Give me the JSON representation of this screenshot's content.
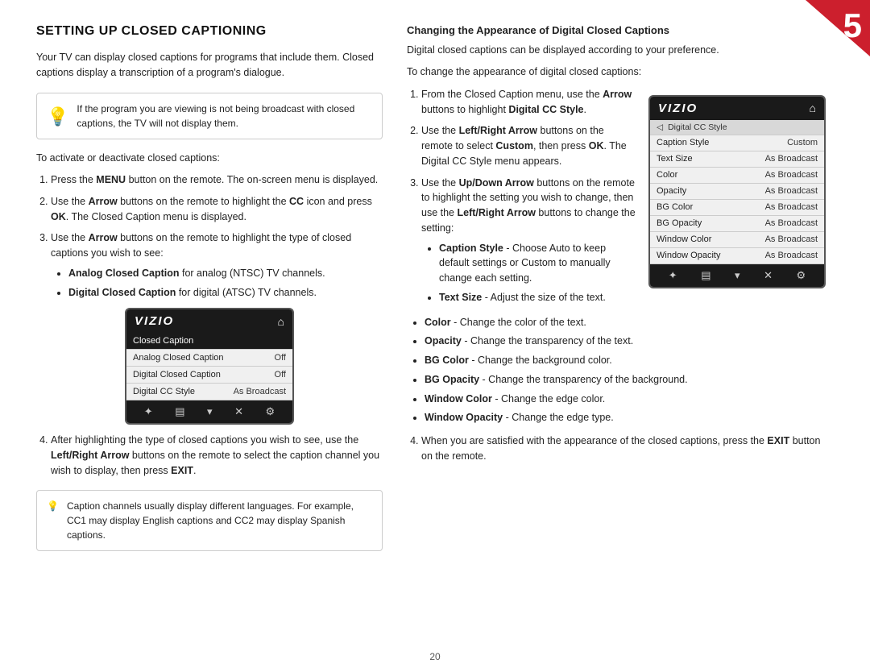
{
  "page": {
    "number": "20",
    "badge_number": "5"
  },
  "left": {
    "section_title": "SETTING UP CLOSED CAPTIONING",
    "intro_text": "Your TV can display closed captions for programs that include them. Closed captions display a transcription of a program's dialogue.",
    "info_note": "If the program you are viewing is not being broadcast with closed captions, the TV will not display them.",
    "activate_text": "To activate or deactivate closed captions:",
    "steps": [
      {
        "id": 1,
        "text": "Press the MENU button on the remote. The on-screen menu is displayed.",
        "bold_word": "MENU"
      },
      {
        "id": 2,
        "text": "Use the Arrow buttons on the remote to highlight the CC icon and press OK. The Closed Caption menu is displayed.",
        "bold_words": [
          "Arrow",
          "OK"
        ]
      },
      {
        "id": 3,
        "text": "Use the Arrow buttons on the remote to highlight the type of closed captions you wish to see:",
        "bold_words": [
          "Arrow"
        ],
        "bullets": [
          {
            "bold": "Analog Closed Caption",
            "rest": " for analog (NTSC) TV channels."
          },
          {
            "bold": "Digital Closed Caption",
            "rest": " for digital (ATSC) TV channels."
          }
        ]
      },
      {
        "id": 4,
        "text": "After highlighting the type of closed captions you wish to see, use the Left/Right Arrow buttons on the remote to select the caption channel you wish to display, then press EXIT.",
        "bold_words": [
          "Left/Right Arrow",
          "EXIT"
        ]
      }
    ],
    "bottom_note": "Caption channels usually display different languages. For example, CC1 may display English captions and CC2 may display Spanish captions.",
    "menu": {
      "logo": "VIZIO",
      "rows": [
        {
          "label": "Closed Caption",
          "value": "",
          "highlighted": true
        },
        {
          "label": "Analog Closed Caption",
          "value": "Off",
          "highlighted": false
        },
        {
          "label": "Digital Closed Caption",
          "value": "Off",
          "highlighted": false
        },
        {
          "label": "Digital CC Style",
          "value": "As Broadcast",
          "highlighted": false
        }
      ]
    }
  },
  "right": {
    "subsection_title": "Changing the Appearance of Digital Closed Captions",
    "intro": "Digital closed captions can be displayed according to your preference.",
    "to_change": "To change the appearance of digital closed captions:",
    "steps": [
      {
        "id": 1,
        "text": "From the Closed Caption menu, use the Arrow buttons to highlight Digital CC Style.",
        "bold_words": [
          "Arrow",
          "Digital CC Style"
        ]
      },
      {
        "id": 2,
        "text": "Use the Left/Right Arrow buttons on the remote to select Custom, then press OK. The Digital CC Style menu appears.",
        "bold_words": [
          "Left/Right Arrow",
          "Custom",
          "OK"
        ]
      },
      {
        "id": 3,
        "text": "Use the Up/Down Arrow buttons on the remote to highlight the setting you wish to change, then use the Left/Right Arrow buttons to change the setting:",
        "bold_words": [
          "Up/Down Arrow",
          "Left/",
          "Right Arrow"
        ],
        "bullets": [
          {
            "bold": "Caption Style",
            "rest": " - Choose Auto to keep default settings or Custom to manually change each setting."
          },
          {
            "bold": "Text Size",
            "rest": " - Adjust the size of the text."
          }
        ]
      }
    ],
    "bullets": [
      {
        "bold": "Color",
        "rest": " - Change the color of the text."
      },
      {
        "bold": "Opacity",
        "rest": " - Change the transparency of the text."
      },
      {
        "bold": "BG Color",
        "rest": " - Change the background color."
      },
      {
        "bold": "BG Opacity",
        "rest": " - Change the transparency of the background."
      },
      {
        "bold": "Window Color",
        "rest": " - Change the edge color."
      },
      {
        "bold": "Window Opacity",
        "rest": " - Change the edge type."
      }
    ],
    "final_step": {
      "id": 4,
      "text": "When you are satisfied with the appearance of the closed captions, press the EXIT button on the remote.",
      "bold_words": [
        "EXIT"
      ]
    },
    "menu": {
      "logo": "VIZIO",
      "sub_header": "Digital CC Style",
      "rows": [
        {
          "label": "Caption Style",
          "value": "Custom"
        },
        {
          "label": "Text Size",
          "value": "As Broadcast"
        },
        {
          "label": "Color",
          "value": "As Broadcast"
        },
        {
          "label": "Opacity",
          "value": "As Broadcast"
        },
        {
          "label": "BG Color",
          "value": "As Broadcast"
        },
        {
          "label": "BG Opacity",
          "value": "As Broadcast"
        },
        {
          "label": "Window Color",
          "value": "As Broadcast"
        },
        {
          "label": "Window Opacity",
          "value": "As Broadcast"
        }
      ]
    }
  }
}
